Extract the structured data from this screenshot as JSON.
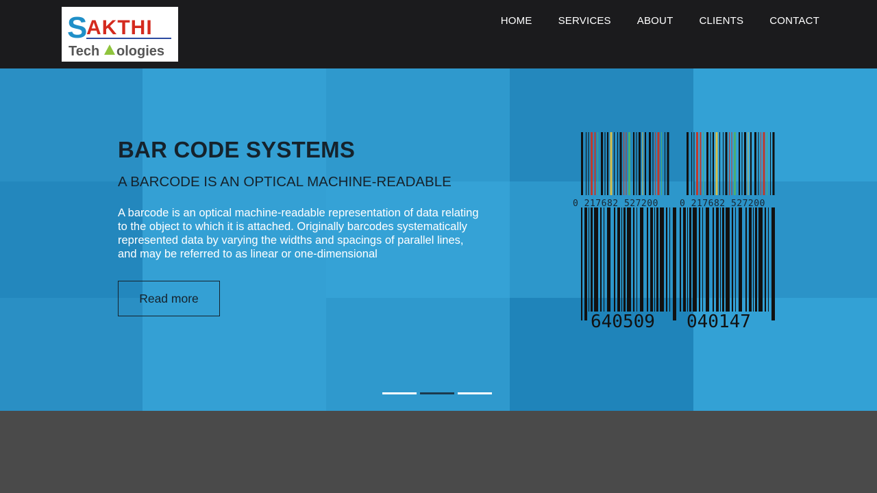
{
  "brand": {
    "logo_line1": "SAKTHI",
    "logo_line2": "Technologies",
    "colors": {
      "blue": "#1f8fc8",
      "red": "#d42a1e",
      "gray": "#555555",
      "green": "#8fc43d"
    }
  },
  "nav": {
    "items": [
      {
        "label": "HOME"
      },
      {
        "label": "SERVICES"
      },
      {
        "label": "ABOUT"
      },
      {
        "label": "CLIENTS"
      },
      {
        "label": "CONTACT"
      }
    ]
  },
  "hero": {
    "title": "BAR CODE SYSTEMS",
    "subtitle": "A BARCODE IS AN OPTICAL MACHINE-READABLE",
    "text": "A barcode is an optical machine-readable representation of data relating to the object to which it is attached. Originally barcodes systematically represented data by varying the widths and spacings of parallel lines, and may be referred to as linear or one-dimensional",
    "button_label": "Read more",
    "barcode_small_digits": "0 217682 527200",
    "barcode_large_left": "640509",
    "barcode_large_right": "040147",
    "background_color": "#2b95c9",
    "slides": {
      "count": 3,
      "active_index": 1
    }
  }
}
